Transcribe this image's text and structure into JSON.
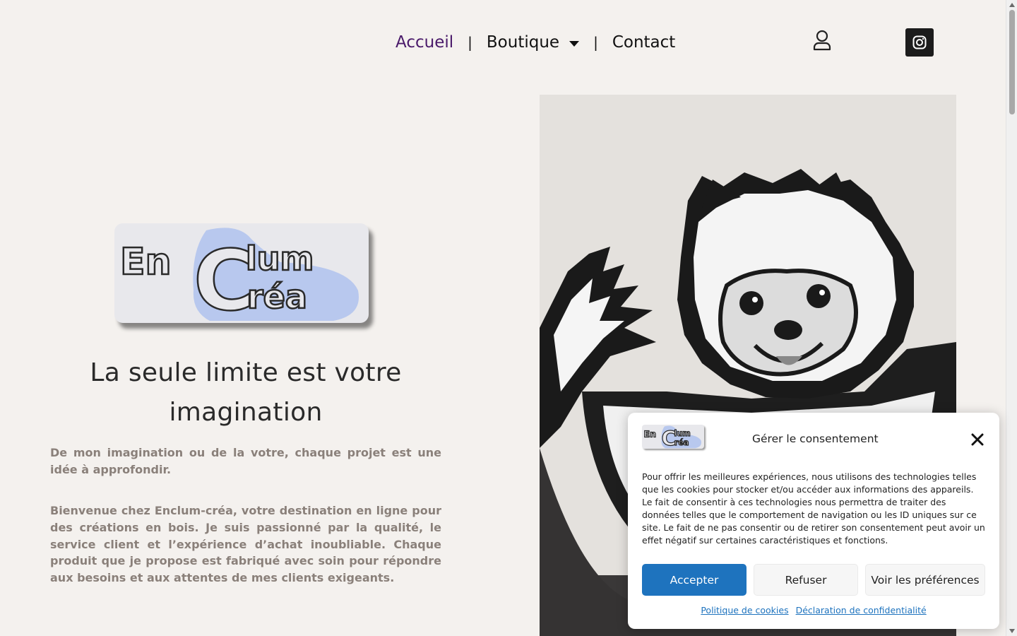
{
  "nav": {
    "items": [
      {
        "label": "Accueil"
      },
      {
        "label": "Boutique"
      },
      {
        "label": "Contact"
      }
    ],
    "separator": "|",
    "colors": {
      "active": "#4a1a6a",
      "default": "#111111"
    }
  },
  "icons": {
    "user": "user-icon",
    "instagram": "instagram-icon",
    "dropdown": "chevron-down-icon",
    "close": "close-icon"
  },
  "logo": {
    "line1": "En",
    "big_letter": "C",
    "line1b": "lum",
    "line2": "réa"
  },
  "hero": {
    "headline": "La seule limite est votre imagination",
    "paragraph1": "De mon imagination ou de la votre, chaque projet est une idée à approfondir.",
    "paragraph2": "Bienvenue chez Enclum-créa, votre destination en ligne pour des créations en bois. Je suis passionné par la qualité, le service client et l’expérience d’achat inoubliable. Chaque produit que je propose est fabriqué avec soin pour répondre aux besoins et aux attentes de mes clients exigeants."
  },
  "consent": {
    "title": "Gérer le consentement",
    "text": "Pour offrir les meilleures expériences, nous utilisons des technologies telles que les cookies pour stocker et/ou accéder aux informations des appareils. Le fait de consentir à ces technologies nous permettra de traiter des données telles que le comportement de navigation ou les ID uniques sur ce site. Le fait de ne pas consentir ou de retirer son consentement peut avoir un effet négatif sur certaines caractéristiques et fonctions.",
    "accept": "Accepter",
    "refuse": "Refuser",
    "preferences": "Voir les préférences",
    "link_cookies": "Politique de cookies",
    "link_privacy": "Déclaration de confidentialité",
    "colors": {
      "accept_bg": "#1e73be",
      "link": "#1e73be"
    }
  },
  "colors": {
    "page_bg": "#f4f1ee",
    "paragraph": "#8a807a",
    "logo_highlight": "#b8c8ee"
  }
}
